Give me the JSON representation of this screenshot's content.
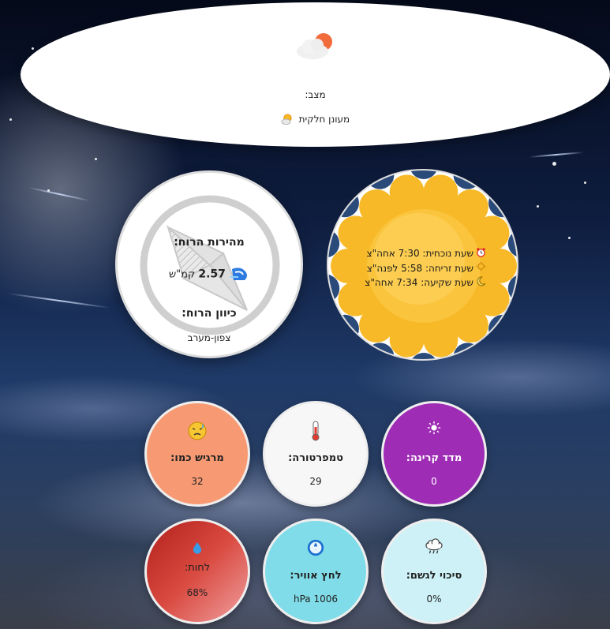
{
  "status": {
    "label": "מצב:",
    "value": "מעונן חלקית",
    "icon": "partly-cloudy-icon"
  },
  "wind": {
    "speed_title": "מהירות הרוח:",
    "speed_value": "2.57",
    "speed_unit": "קמ\"ש",
    "direction_title": "כיוון הרוח:",
    "direction_value": "צפון-מערב",
    "icon": "wind-icon"
  },
  "sun": {
    "current_time": "שעת נוכחית: 7:30 אחה\"צ",
    "sunrise": "שעת זריחה: 5:58 לפנה\"צ",
    "sunset": "שעת שקיעה: 7:34 אחה\"צ"
  },
  "metrics": {
    "feels_like": {
      "label": "מרגיש כמו:",
      "value": "32",
      "icon": "hot-face-icon",
      "color": "#f79a73"
    },
    "temperature": {
      "label": "טמפרטורה:",
      "value": "29",
      "icon": "thermometer-icon",
      "color": "#f7f7f7"
    },
    "uv": {
      "label": "מדד קרינה:",
      "value": "0",
      "icon": "uv-sun-icon",
      "color": "#9e2cb5"
    },
    "humidity": {
      "label": "לחות:",
      "value": "68%",
      "icon": "droplet-icon",
      "color": "#c2302a"
    },
    "pressure": {
      "label": "לחץ אוויר:",
      "value": "1006 hPa",
      "icon": "pressure-gauge-icon",
      "color": "#80dce8"
    },
    "rain": {
      "label": "סיכוי לגשם:",
      "value": "0%",
      "icon": "rain-cloud-icon",
      "color": "#cdf1f6"
    }
  }
}
